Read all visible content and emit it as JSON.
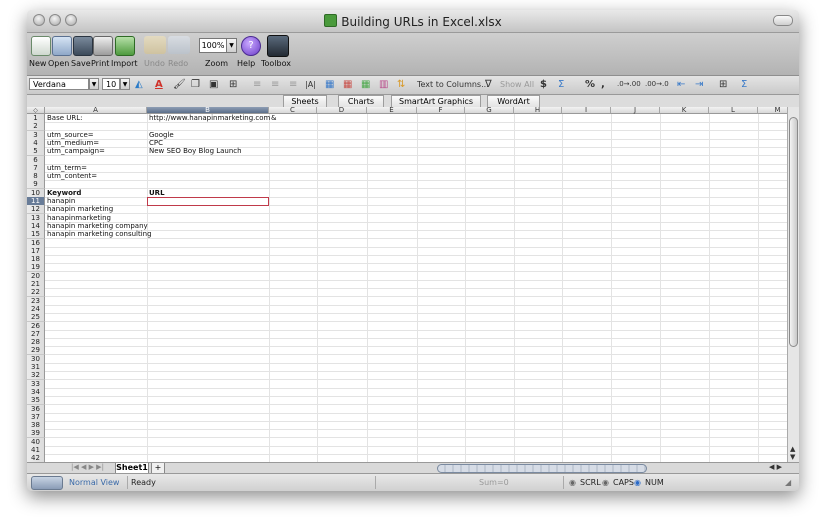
{
  "window": {
    "title": "Building URLs in Excel.xlsx"
  },
  "toolbar": {
    "items": [
      {
        "label": "New",
        "icon": "new-icon"
      },
      {
        "label": "Open",
        "icon": "open-icon"
      },
      {
        "label": "Save",
        "icon": "save-icon"
      },
      {
        "label": "Print",
        "icon": "print-icon"
      },
      {
        "label": "Import",
        "icon": "import-icon"
      },
      {
        "label": "Undo",
        "icon": "undo-icon"
      },
      {
        "label": "Redo",
        "icon": "redo-icon"
      },
      {
        "label": "Zoom",
        "icon": "zoom-icon"
      },
      {
        "label": "Help",
        "icon": "help-icon"
      },
      {
        "label": "Toolbox",
        "icon": "toolbox-icon"
      }
    ],
    "zoom_value": "100%"
  },
  "format": {
    "font_name": "Verdana",
    "font_size": "10",
    "text_to_columns": "Text to Columns...",
    "show_all": "Show All"
  },
  "ribbon_tabs": [
    "Sheets",
    "Charts",
    "SmartArt Graphics",
    "WordArt"
  ],
  "columns": [
    "A",
    "B",
    "C",
    "D",
    "E",
    "F",
    "G",
    "H",
    "I",
    "J",
    "K",
    "L",
    "M"
  ],
  "selected_column": "B",
  "selected_row": 11,
  "cells": [
    {
      "row": 1,
      "A": "Base URL:",
      "B": "http://www.hanapinmarketing.com",
      "C": "&"
    },
    {
      "row": 3,
      "A": "utm_source=",
      "B": "Google"
    },
    {
      "row": 4,
      "A": "utm_medium=",
      "B": "CPC"
    },
    {
      "row": 5,
      "A": "utm_campaign=",
      "B": "New SEO Boy Blog Launch"
    },
    {
      "row": 7,
      "A": "utm_term="
    },
    {
      "row": 8,
      "A": "utm_content="
    },
    {
      "row": 10,
      "A": "Keyword",
      "B": "URL",
      "bold": true
    },
    {
      "row": 11,
      "A": "hanapin"
    },
    {
      "row": 12,
      "A": "hanapin marketing"
    },
    {
      "row": 13,
      "A": "hanapinmarketing"
    },
    {
      "row": 14,
      "A": "hanapin marketing company"
    },
    {
      "row": 15,
      "A": "hanapin marketing consulting"
    }
  ],
  "sheets": {
    "tabs": [
      "Sheet1"
    ],
    "add_label": "+"
  },
  "status": {
    "view": "Normal View",
    "state": "Ready",
    "sum": "Sum=0",
    "scrl": "SCRL",
    "caps": "CAPS",
    "num": "NUM"
  }
}
